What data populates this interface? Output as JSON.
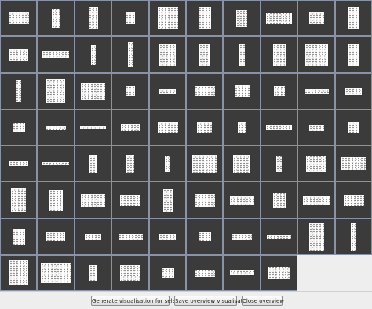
{
  "grid": {
    "columns": 10,
    "rows": 8,
    "thumbnails": [
      {
        "w": 0.55,
        "h": 0.35
      },
      {
        "w": 0.2,
        "h": 0.55
      },
      {
        "w": 0.25,
        "h": 0.6
      },
      {
        "w": 0.25,
        "h": 0.35
      },
      {
        "w": 0.55,
        "h": 0.6
      },
      {
        "w": 0.35,
        "h": 0.6
      },
      {
        "w": 0.3,
        "h": 0.45
      },
      {
        "w": 0.7,
        "h": 0.3
      },
      {
        "w": 0.4,
        "h": 0.35
      },
      {
        "w": 0.3,
        "h": 0.6
      },
      {
        "w": 0.5,
        "h": 0.35
      },
      {
        "w": 0.7,
        "h": 0.2
      },
      {
        "w": 0.12,
        "h": 0.55
      },
      {
        "w": 0.15,
        "h": 0.65
      },
      {
        "w": 0.45,
        "h": 0.6
      },
      {
        "w": 0.3,
        "h": 0.6
      },
      {
        "w": 0.15,
        "h": 0.6
      },
      {
        "w": 0.35,
        "h": 0.6
      },
      {
        "w": 0.6,
        "h": 0.6
      },
      {
        "w": 0.3,
        "h": 0.6
      },
      {
        "w": 0.15,
        "h": 0.6
      },
      {
        "w": 0.5,
        "h": 0.65
      },
      {
        "w": 0.65,
        "h": 0.45
      },
      {
        "w": 0.25,
        "h": 0.25
      },
      {
        "w": 0.45,
        "h": 0.15
      },
      {
        "w": 0.55,
        "h": 0.25
      },
      {
        "w": 0.4,
        "h": 0.35
      },
      {
        "w": 0.3,
        "h": 0.25
      },
      {
        "w": 0.65,
        "h": 0.15
      },
      {
        "w": 0.45,
        "h": 0.2
      },
      {
        "w": 0.35,
        "h": 0.25
      },
      {
        "w": 0.55,
        "h": 0.1
      },
      {
        "w": 0.7,
        "h": 0.08
      },
      {
        "w": 0.5,
        "h": 0.2
      },
      {
        "w": 0.55,
        "h": 0.3
      },
      {
        "w": 0.4,
        "h": 0.3
      },
      {
        "w": 0.2,
        "h": 0.3
      },
      {
        "w": 0.7,
        "h": 0.12
      },
      {
        "w": 0.4,
        "h": 0.15
      },
      {
        "w": 0.3,
        "h": 0.3
      },
      {
        "w": 0.5,
        "h": 0.12
      },
      {
        "w": 0.7,
        "h": 0.08
      },
      {
        "w": 0.2,
        "h": 0.5
      },
      {
        "w": 0.2,
        "h": 0.5
      },
      {
        "w": 0.15,
        "h": 0.45
      },
      {
        "w": 0.65,
        "h": 0.5
      },
      {
        "w": 0.45,
        "h": 0.5
      },
      {
        "w": 0.15,
        "h": 0.45
      },
      {
        "w": 0.55,
        "h": 0.45
      },
      {
        "w": 0.65,
        "h": 0.35
      },
      {
        "w": 0.4,
        "h": 0.65
      },
      {
        "w": 0.35,
        "h": 0.55
      },
      {
        "w": 0.65,
        "h": 0.35
      },
      {
        "w": 0.55,
        "h": 0.3
      },
      {
        "w": 0.25,
        "h": 0.6
      },
      {
        "w": 0.55,
        "h": 0.35
      },
      {
        "w": 0.65,
        "h": 0.25
      },
      {
        "w": 0.35,
        "h": 0.4
      },
      {
        "w": 0.7,
        "h": 0.25
      },
      {
        "w": 0.55,
        "h": 0.3
      },
      {
        "w": 0.35,
        "h": 0.45
      },
      {
        "w": 0.5,
        "h": 0.25
      },
      {
        "w": 0.45,
        "h": 0.15
      },
      {
        "w": 0.65,
        "h": 0.15
      },
      {
        "w": 0.45,
        "h": 0.15
      },
      {
        "w": 0.35,
        "h": 0.25
      },
      {
        "w": 0.55,
        "h": 0.15
      },
      {
        "w": 0.65,
        "h": 0.1
      },
      {
        "w": 0.4,
        "h": 0.75
      },
      {
        "w": 0.15,
        "h": 0.75
      },
      {
        "w": 0.5,
        "h": 0.7
      },
      {
        "w": 0.8,
        "h": 0.55
      },
      {
        "w": 0.2,
        "h": 0.45
      },
      {
        "w": 0.55,
        "h": 0.45
      },
      {
        "w": 0.35,
        "h": 0.25
      },
      {
        "w": 0.55,
        "h": 0.2
      },
      {
        "w": 0.65,
        "h": 0.12
      },
      {
        "w": 0.6,
        "h": 0.35
      }
    ]
  },
  "buttons": {
    "generate": "Generate visualisation for selected",
    "save": "Save overview visualisations",
    "close": "Close overview"
  }
}
